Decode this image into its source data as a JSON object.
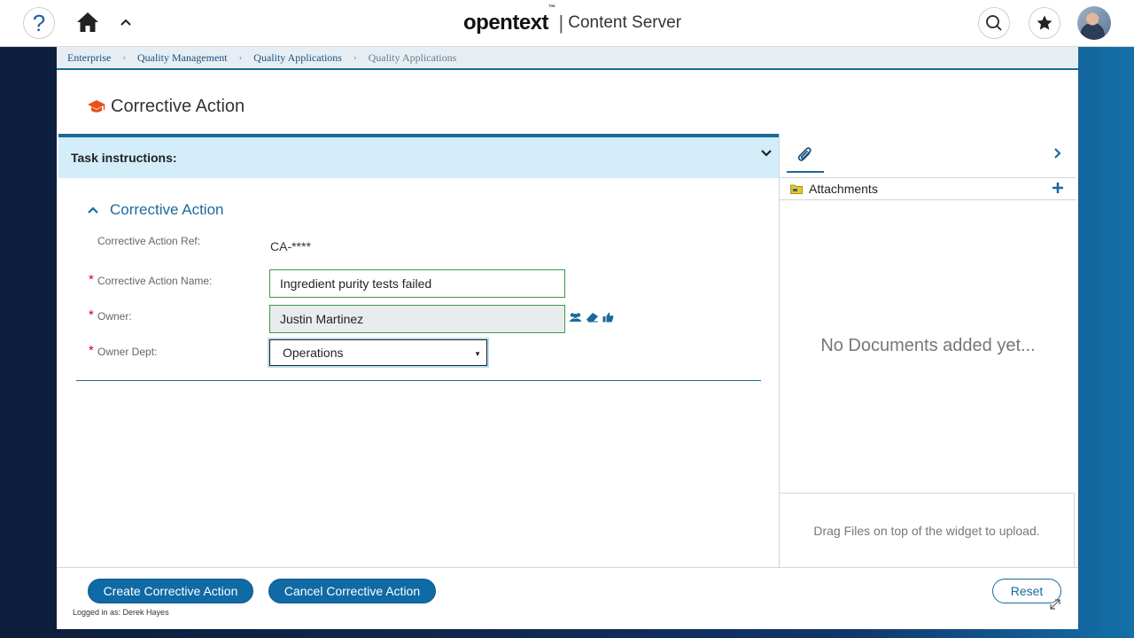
{
  "topbar": {
    "help_glyph": "?",
    "brand_logo": "opentext",
    "brand_tm": "™",
    "brand_separator": "|",
    "brand_product": "Content Server",
    "icons": [
      "help-icon",
      "home-icon",
      "chevron-up-icon",
      "search-icon",
      "star-icon",
      "avatar"
    ]
  },
  "breadcrumb": {
    "items": [
      "Enterprise",
      "Quality Management",
      "Quality Applications",
      "Quality Applications"
    ],
    "separator": "›"
  },
  "page": {
    "title": "Corrective Action",
    "title_icon": "graduation-cap-icon"
  },
  "task": {
    "label": "Task instructions:"
  },
  "form": {
    "section_title": "Corrective Action",
    "required_mark": "*",
    "ref_label": "Corrective Action Ref:",
    "ref_value": "CA-****",
    "name_label": "Corrective Action Name:",
    "name_value": "Ingredient purity tests failed",
    "owner_label": "Owner:",
    "owner_value": "Justin Martinez",
    "owner_icons": [
      "users-icon",
      "eraser-icon",
      "thumbs-up-icon"
    ],
    "dept_label": "Owner Dept:",
    "dept_value": "Operations",
    "dept_arrow": "▼"
  },
  "attachments": {
    "header": "Attachments",
    "empty_message": "No Documents added yet...",
    "drop_message": "Drag Files on top of the widget to upload.",
    "icons": [
      "paperclip-icon",
      "chevron-right-icon",
      "folder-icon",
      "plus-icon"
    ]
  },
  "footer": {
    "create_label": "Create Corrective Action",
    "cancel_label": "Cancel Corrective Action",
    "reset_label": "Reset",
    "logged_in": "Logged in as: Derek Hayes"
  },
  "colors": {
    "accent": "#1a6a9a",
    "primary_button": "#0f6aa6",
    "required": "#d0021b",
    "valid_border": "#3b9a46",
    "task_bar": "#d4edfa"
  }
}
